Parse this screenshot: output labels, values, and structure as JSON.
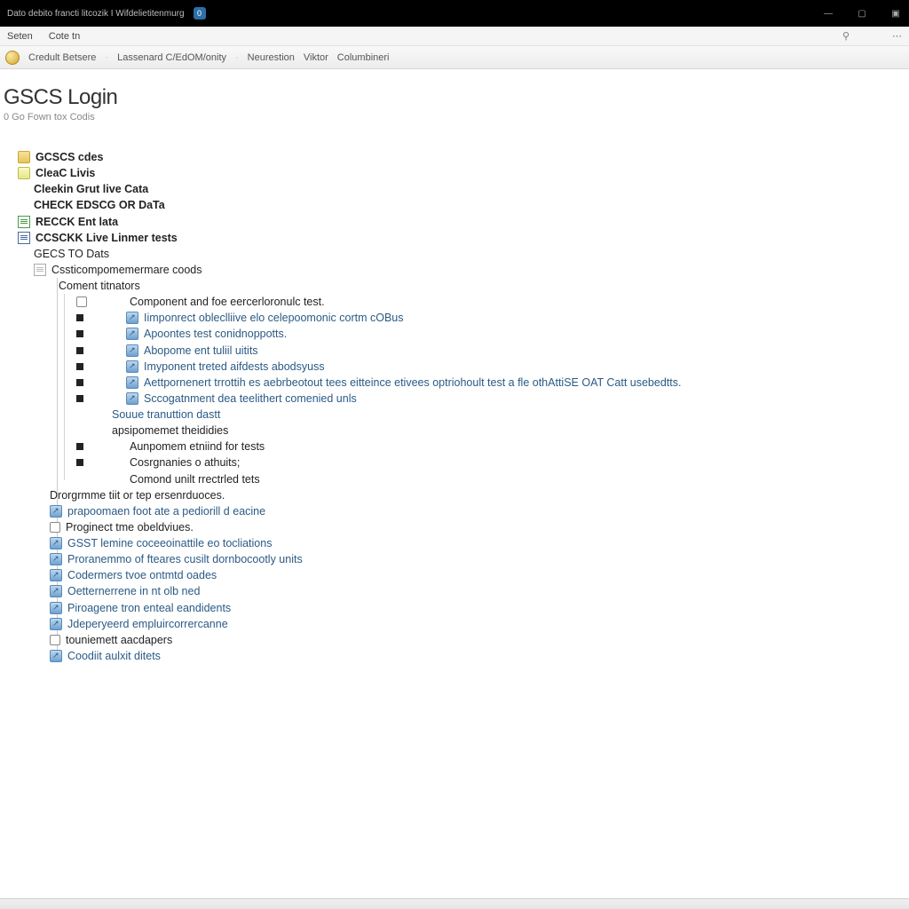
{
  "titlebar": {
    "tab_text": "Dato debito francti litcozik I Wifdelietitenmurg",
    "badge": "0"
  },
  "menubar": {
    "items": [
      "Seten",
      "Cote tn"
    ]
  },
  "toolbar": {
    "crumbs": [
      "Credult Betsere",
      "Lassenard C/EdOM/onity",
      "Neurestion",
      "Viktor",
      "Columbineri"
    ]
  },
  "page": {
    "title": "GSCS Login",
    "subtitle": "0 Go Fown tox Codis"
  },
  "tree": {
    "n0": "GCSCS cdes",
    "n1": "CleaC Livis",
    "n2": "Cleekin Grut live Cata",
    "n3": "CHECK EDSCG OR DaTa",
    "n4": "RECCK Ent lata",
    "n5": "CCSCKK Live Linmer tests",
    "n6": "GECS TO Dats",
    "n7": "Cssticompomemermare coods",
    "n8": "Coment titnators",
    "c0": "Component and foe eercerloronulc test.",
    "c1": "Iimponrect obleclliive elo celepoomonic cortm cOBus",
    "c2": "Apoontes test conidnoppotts.",
    "c3": "Abopome ent tuliil uitits",
    "c4": "Imyponent treted aifdests abodsyuss",
    "c5": "Aettpornenert trrottih es aebrbeotout tees eitteince etivees optriohoult test a fle othAttiSE OAT Catt usebedtts.",
    "c6": "Sccogatnment dea teelithert comenied unls",
    "c7": "Souue tranuttion dastt",
    "c8": "apsipomemet theididies",
    "c9": "Aunpomem etniind for tests",
    "c10": "Cosrgnanies o athuits;",
    "c11": "Comond unilt rrectrled tets",
    "p_head": "Drorgrmme tiit or tep ersenrduoces.",
    "p0": "prapoomaen foot ate a pediorill d eacine",
    "p1": "Proginect tme obeldviues.",
    "p2": "GSST lemine coceeoinattile eo tocliations",
    "p3": "Proranemmo of fteares cusilt dornbocootly units",
    "p4": "Codermers tvoe ontmtd oades",
    "p5": "Oetternerrene in nt olb ned",
    "p6": "Piroagene tron enteal eandidents",
    "p7": "Jdeperyeerd empluircorrercanne",
    "p8": "touniemett aacdapers",
    "p9": "Coodiit aulxit ditets"
  }
}
